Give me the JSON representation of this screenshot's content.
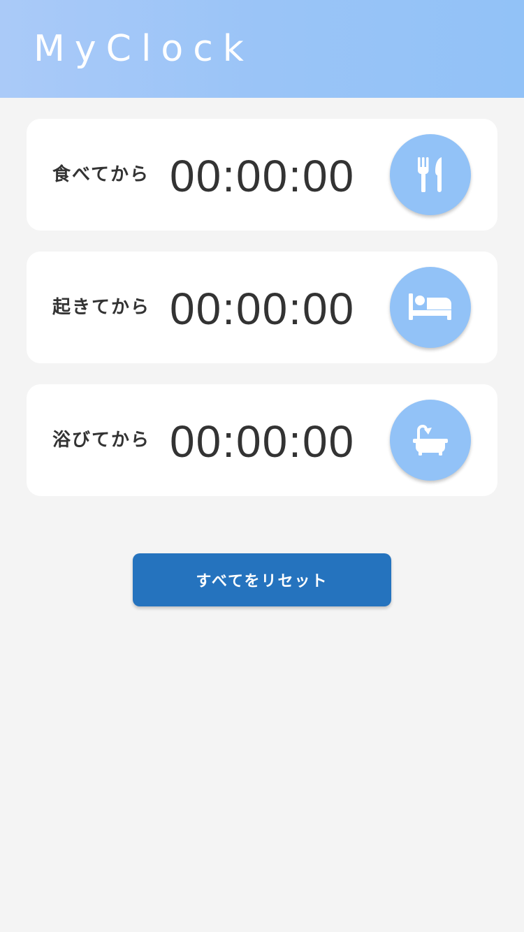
{
  "header": {
    "title": "MyClock"
  },
  "timers": [
    {
      "label": "食べてから",
      "time": "00:00:00",
      "icon": "utensils-icon"
    },
    {
      "label": "起きてから",
      "time": "00:00:00",
      "icon": "bed-icon"
    },
    {
      "label": "浴びてから",
      "time": "00:00:00",
      "icon": "bath-icon"
    }
  ],
  "reset_label": "すべてをリセット",
  "colors": {
    "header_gradient_start": "#aacaf8",
    "header_gradient_end": "#92c2f7",
    "icon_button": "#92c2f7",
    "reset_button": "#2573be",
    "background": "#f4f4f4",
    "text": "#333333"
  }
}
